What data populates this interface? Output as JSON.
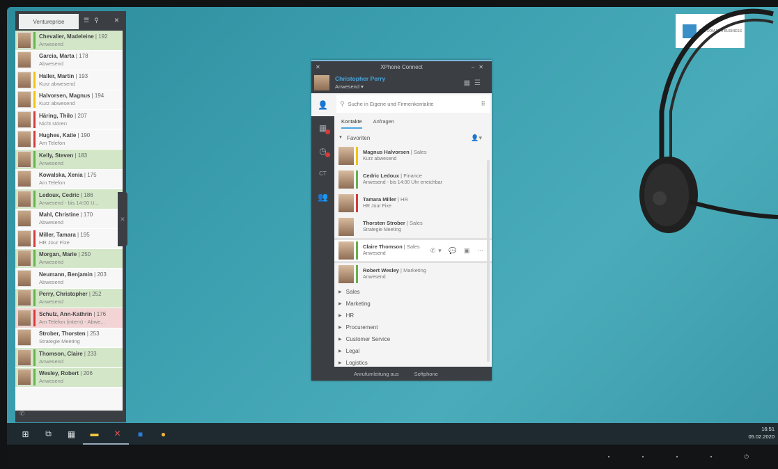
{
  "sidebar": {
    "tab_label": "Ventureprise",
    "contacts": [
      {
        "name": "Chevalier, Madeleine",
        "ext": "192",
        "status": "Anwesend",
        "state": "green",
        "bar": "#6ab04c"
      },
      {
        "name": "Garcia, Marta",
        "ext": "178",
        "status": "Abwesend",
        "state": "none",
        "bar": ""
      },
      {
        "name": "Haller, Martin",
        "ext": "193",
        "status": "Kurz abwesend",
        "state": "none",
        "bar": "#f1c40f"
      },
      {
        "name": "Halvorsen, Magnus",
        "ext": "194",
        "status": "Kurz abwesend",
        "state": "none",
        "bar": "#f1c40f"
      },
      {
        "name": "Häring, Thilo",
        "ext": "207",
        "status": "Nicht stören",
        "state": "none",
        "bar": "#d43c3c"
      },
      {
        "name": "Hughes, Katie",
        "ext": "190",
        "status": "Am Telefon",
        "state": "none",
        "bar": "#d43c3c"
      },
      {
        "name": "Kelly, Steven",
        "ext": "183",
        "status": "Anwesend",
        "state": "green",
        "bar": "#6ab04c"
      },
      {
        "name": "Kowalska, Xenia",
        "ext": "175",
        "status": "Am Telefon",
        "state": "none",
        "bar": ""
      },
      {
        "name": "Ledoux, Cedric",
        "ext": "186",
        "status": "Anwesend - bis 14:00 U...",
        "state": "green",
        "bar": "#6ab04c"
      },
      {
        "name": "Mahl, Christine",
        "ext": "170",
        "status": "Abwesend",
        "state": "none",
        "bar": ""
      },
      {
        "name": "Miller, Tamara",
        "ext": "195",
        "status": "HR Jour Fixe",
        "state": "none",
        "bar": "#d43c3c"
      },
      {
        "name": "Morgan, Marie",
        "ext": "250",
        "status": "Anwesend",
        "state": "green",
        "bar": "#6ab04c"
      },
      {
        "name": "Neumann, Benjamin",
        "ext": "203",
        "status": "Abwesend",
        "state": "none",
        "bar": ""
      },
      {
        "name": "Perry, Christopher",
        "ext": "252",
        "status": "Anwesend",
        "state": "green",
        "bar": "#6ab04c"
      },
      {
        "name": "Schulz, Ann-Kathrin",
        "ext": "176",
        "status": "Am Telefon (intern) - Abwe...",
        "state": "red",
        "bar": "#d43c3c"
      },
      {
        "name": "Strober, Thorsten",
        "ext": "253",
        "status": "Strategie Meeting",
        "state": "none",
        "bar": ""
      },
      {
        "name": "Thomson, Claire",
        "ext": "233",
        "status": "Anwesend",
        "state": "green",
        "bar": "#6ab04c"
      },
      {
        "name": "Wesley, Robert",
        "ext": "206",
        "status": "Anwesend",
        "state": "green",
        "bar": "#6ab04c"
      }
    ]
  },
  "xphone": {
    "title": "XPhone Connect",
    "user_name": "Christopher Perry",
    "user_status": "Anwesend ▾",
    "search_placeholder": "Suche in Eigene und Firmenkontakte",
    "tab_contacts": "Kontakte",
    "tab_requests": "Anfragen",
    "favorites_label": "Favoriten",
    "favorites": [
      {
        "name": "Magnus Halvorsen",
        "dept": "Sales",
        "status": "Kurz abwesend",
        "bar": "#f1c40f"
      },
      {
        "name": "Cedric Ledoux",
        "dept": "Finance",
        "status": "Anwesend - bis 14:00 Uhr erreichbar",
        "bar": "#6ab04c"
      },
      {
        "name": "Tamara Miller",
        "dept": "HR",
        "status": "HR Jour Fixe",
        "bar": "#d43c3c"
      },
      {
        "name": "Thorsten Strober",
        "dept": "Sales",
        "status": "Strategie Meeting",
        "bar": ""
      },
      {
        "name": "Claire Thomson",
        "dept": "Sales",
        "status": "Anwesend",
        "bar": "#6ab04c"
      },
      {
        "name": "Robert Wesley",
        "dept": "Marketing",
        "status": "Anwesend",
        "bar": "#6ab04c"
      }
    ],
    "groups": [
      "Sales",
      "Marketing",
      "HR",
      "Procurement",
      "Customer Service",
      "Legal",
      "Logistics"
    ],
    "footer_forwarding": "Anrufumleitung aus",
    "footer_softphone": "Softphone"
  },
  "logo_text": "CAS COM FOR BUSINESS",
  "taskbar": {
    "time": "16:51",
    "date": "05.02.2020"
  },
  "colors": {
    "accent": "#4aa5dd",
    "present": "#6ab04c",
    "busy": "#d43c3c",
    "away": "#f1c40f"
  }
}
